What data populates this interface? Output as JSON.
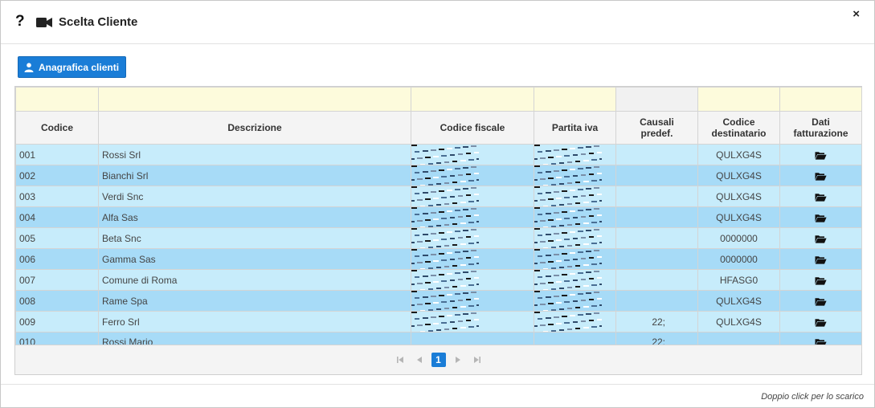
{
  "dialog": {
    "help_glyph": "?",
    "title": "Scelta Cliente",
    "close_glyph": "×",
    "accent_color": "#1a7dd7"
  },
  "toolbar": {
    "anagrafica_label": "Anagrafica clienti",
    "anagrafica_icon": "user-icon"
  },
  "table": {
    "columns": [
      "Codice",
      "Descrizione",
      "Codice fiscale",
      "Partita iva",
      "Causali predef.",
      "Codice destinatario",
      "Dati fatturazione"
    ],
    "rows": [
      {
        "codice": "001",
        "descrizione": "Rossi Srl",
        "causali": "",
        "destinatario": "QULXG4S"
      },
      {
        "codice": "002",
        "descrizione": "Bianchi Srl",
        "causali": "",
        "destinatario": "QULXG4S"
      },
      {
        "codice": "003",
        "descrizione": "Verdi Snc",
        "causali": "",
        "destinatario": "QULXG4S"
      },
      {
        "codice": "004",
        "descrizione": "Alfa Sas",
        "causali": "",
        "destinatario": "QULXG4S"
      },
      {
        "codice": "005",
        "descrizione": "Beta Snc",
        "causali": "",
        "destinatario": "0000000"
      },
      {
        "codice": "006",
        "descrizione": "Gamma Sas",
        "causali": "",
        "destinatario": "0000000"
      },
      {
        "codice": "007",
        "descrizione": "Comune di Roma",
        "causali": "",
        "destinatario": "HFASG0"
      },
      {
        "codice": "008",
        "descrizione": "Rame Spa",
        "causali": "",
        "destinatario": "QULXG4S"
      },
      {
        "codice": "009",
        "descrizione": "Ferro Srl",
        "causali": "22;",
        "destinatario": "QULXG4S"
      },
      {
        "codice": "010",
        "descrizione": "Rossi Mario",
        "causali": "22;",
        "destinatario": ""
      }
    ],
    "row_colors": {
      "odd": "#c7ecfb",
      "even": "#a7dbf7"
    },
    "action_icon": "folder-open-icon"
  },
  "pager": {
    "current_page": "1",
    "first_icon": "first-page-icon",
    "prev_icon": "prev-page-icon",
    "next_icon": "next-page-icon",
    "last_icon": "last-page-icon"
  },
  "footer": {
    "hint": "Doppio click per lo scarico"
  }
}
